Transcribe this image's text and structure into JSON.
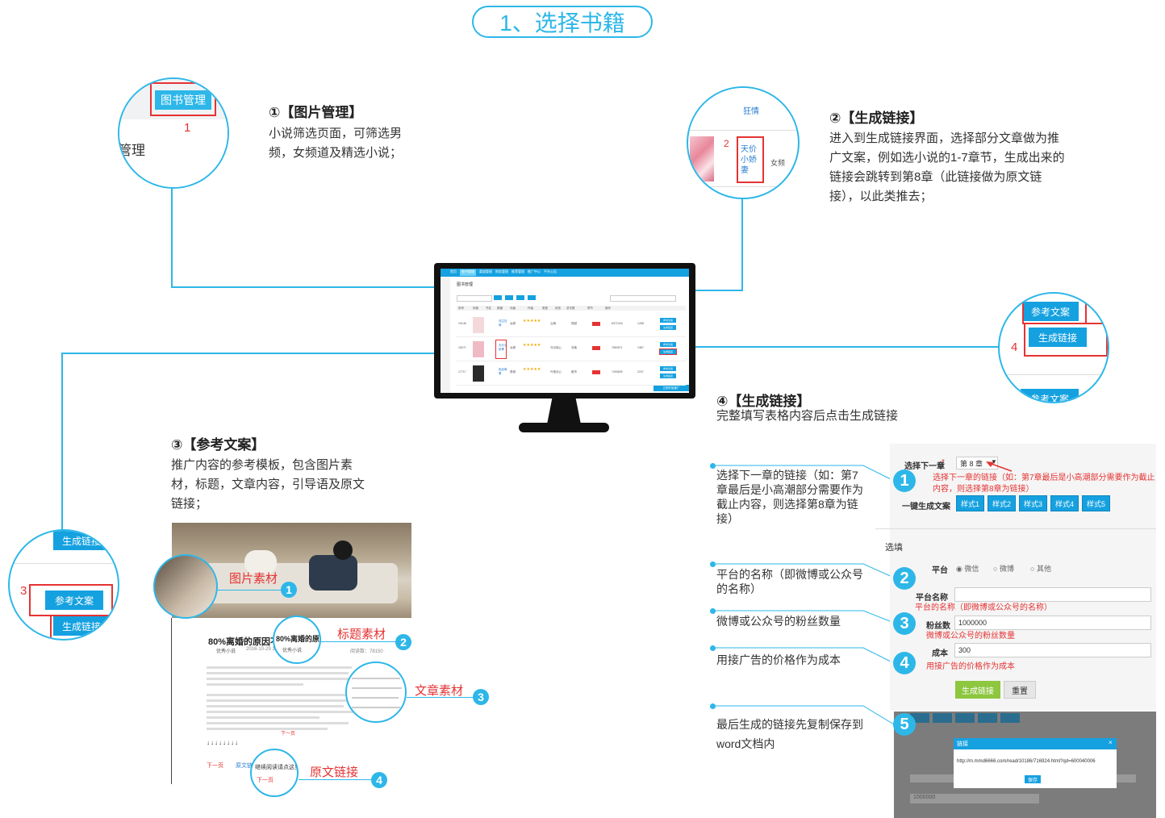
{
  "header": {
    "title": "1、选择书籍"
  },
  "step1": {
    "title": "①【图片管理】",
    "desc": "小说筛选页面，可筛选男频，女频道及精选小说；",
    "zoom_button": "图书管理",
    "zoom_num": "1",
    "zoom_text": "管理"
  },
  "step2": {
    "title": "②【生成链接】",
    "desc": "进入到生成链接界面，选择部分文章做为推广文案，例如选小说的1-7章节，生成出来的链接会跳转到第8章（此链接做为原文链接），以此类推去；",
    "zoom_top": "狂情",
    "zoom_book": "天价小娇妻",
    "zoom_num": "2",
    "zoom_channel": "女频"
  },
  "step3": {
    "title": "③【参考文案】",
    "desc": "推广内容的参考模板，包含图片素材，标题，文章内容，引导语及原文链接；",
    "zoom_btn_top": "生成链接",
    "zoom_btn_ref": "参考文案",
    "zoom_btn_gen": "生成链接",
    "zoom_num": "3",
    "labels": [
      "图片素材",
      "标题素材",
      "文章素材",
      "原文链接"
    ],
    "badges": [
      "1",
      "2",
      "3",
      "4"
    ],
    "article_title": "80%离婚的原因不是",
    "article_title_zoom": "80%离婚的原",
    "article_author": "优秀小说",
    "article_date": "2016-10-29 10:25",
    "article_reads": "阅读数：78150",
    "next_link": "下一页",
    "continue_read": "继续阅读请点这里",
    "original_link": "原文链",
    "next_text": "下一页"
  },
  "step4": {
    "title": "④【生成链接】",
    "desc": "完整填写表格内容后点击生成链接",
    "zoom_ref": "参考文案",
    "zoom_gen": "生成链接",
    "zoom_num": "4",
    "zoom_bottom": "参考文案",
    "annotations": [
      "选择下一章的链接（如：第7章最后是小高潮部分需要作为截止内容，则选择第8章为链接）",
      "平台的名称（即微博或公众号的名称）",
      "微博或公众号的粉丝数量",
      "用接广告的价格作为成本",
      "最后生成的链接先复制保存到word文档内"
    ],
    "badges": [
      "1",
      "2",
      "3",
      "4",
      "5"
    ]
  },
  "form": {
    "next_chapter_label": "选择下一章",
    "next_chapter_value": "第 8 章",
    "next_chapter_note": "选择下一章的链接（如：第7章最后是小高潮部分需要作为截止内容，则选择第8章为链接）",
    "one_click_label": "一键生成文案",
    "styles": [
      "样式1",
      "样式2",
      "样式3",
      "样式4",
      "样式5"
    ],
    "optional_label": "选填",
    "platform_label": "平台",
    "platform_options": [
      "微信",
      "微博",
      "其他"
    ],
    "platform_name_label": "平台名称",
    "platform_name_note": "平台的名称（即微博或公众号的名称）",
    "fans_label": "粉丝数",
    "fans_value": "1000000",
    "fans_note": "微博或公众号的粉丝数量",
    "cost_label": "成本",
    "cost_value": "300",
    "cost_note": "用接广告的价格作为成本",
    "generate_btn": "生成链接",
    "reset_btn": "重置"
  },
  "dialog": {
    "title": "链接",
    "url": "http://m.mmd6666.com/read/10186/716924.html?qd=600040006",
    "save_btn": "保存",
    "bg_value": "1000000"
  },
  "monitor": {
    "nav": [
      "首页",
      "图书管理",
      "渠道管理",
      "财务管理",
      "推荐管理",
      "推广中心",
      "平台公告"
    ],
    "page_title": "图书管理",
    "columns": [
      "序号",
      "封面",
      "书名",
      "频道",
      "评级",
      "作者",
      "类型",
      "状态",
      "总字数",
      "章节",
      "操作"
    ],
    "rows": [
      {
        "id": "19148",
        "title": "领主狂情",
        "channel": "女频",
        "stars": "★★★★★",
        "author": "云阙",
        "type": "穿越",
        "words": "8371018",
        "chapters": "1258"
      },
      {
        "id": "18271",
        "title": "天价小娇妻",
        "channel": "女频",
        "stars": "★★★★★",
        "author": "冷月孤心",
        "type": "总裁",
        "words": "7860571",
        "chapters": "1387"
      },
      {
        "id": "17717",
        "title": "极品萌妻",
        "channel": "男频",
        "stars": "★★★★★",
        "author": "叶落无心",
        "type": "都市",
        "words": "7490825",
        "chapters": "2247"
      }
    ],
    "op_ref": "参考文案",
    "op_gen": "生成链接",
    "bottom_btn": "立即开始推广"
  },
  "colors": {
    "accent": "#2db7e8",
    "button": "#15a1e0",
    "red": "#e53333",
    "green": "#8dc63f"
  }
}
